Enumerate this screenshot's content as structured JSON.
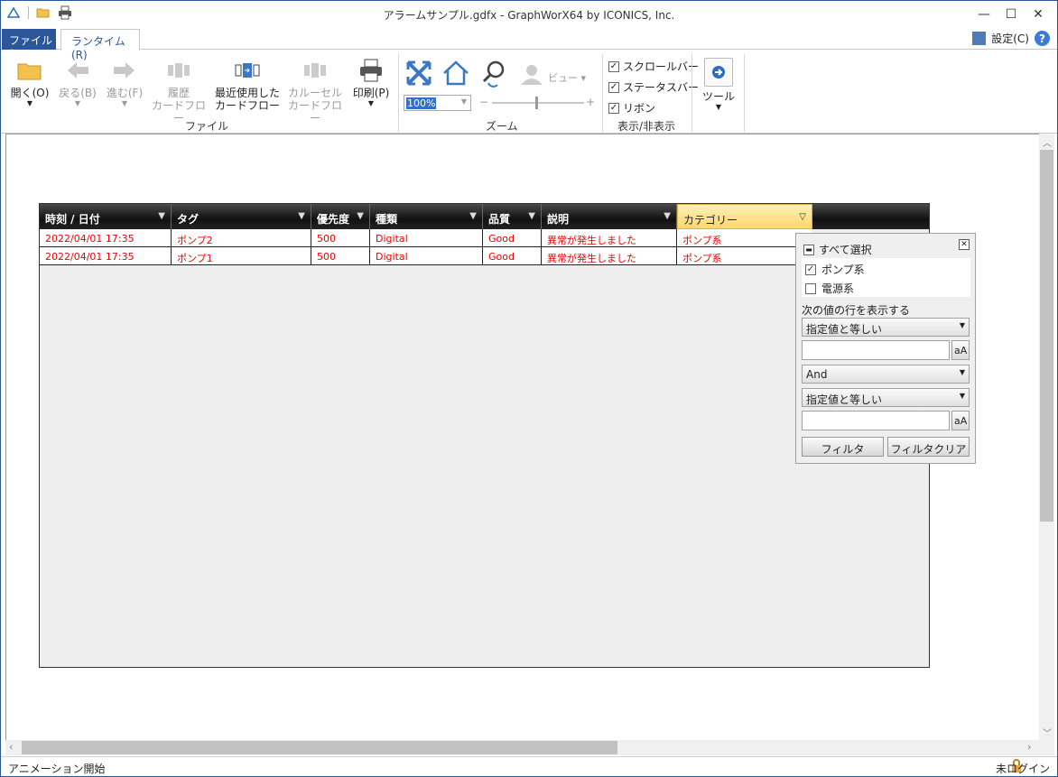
{
  "window": {
    "title": "アラームサンプル.gdfx - GraphWorX64 by ICONICS, Inc."
  },
  "tabs": {
    "file": "ファイル(F",
    "runtime": "ランタイム (R)"
  },
  "settings_label": "設定(C)",
  "help_label": "?",
  "ribbon": {
    "open": "開く(O)",
    "back": "戻る(B)",
    "forward": "進む(F)",
    "history_line1": "履歴",
    "history_line2": "カードフロー",
    "recent_line1": "最近使用した",
    "recent_line2": "カードフロー",
    "carousel_line1": "カルーセル",
    "carousel_line2": "カードフロー",
    "print": "印刷(P)",
    "file_group": "ファイル",
    "view": "ビュー",
    "zoom_value": "100%",
    "zoom_group": "ズーム",
    "zoom_minus": "−",
    "zoom_plus": "+",
    "scrollbar": "スクロールバー",
    "statusbar": "ステータスバー",
    "ribbon": "リボン",
    "show_hide_group": "表示/非表示",
    "tools": "ツール"
  },
  "grid": {
    "columns": [
      "時刻 / 日付",
      "タグ",
      "優先度",
      "種類",
      "品質",
      "説明",
      "カテゴリー"
    ],
    "rows": [
      [
        "2022/04/01 17:35",
        "ポンプ2",
        "500",
        "Digital",
        "Good",
        "異常が発生しました",
        "ポンプ系"
      ],
      [
        "2022/04/01 17:35",
        "ポンプ1",
        "500",
        "Digital",
        "Good",
        "異常が発生しました",
        "ポンプ系"
      ]
    ]
  },
  "filter_popup": {
    "select_all": "すべて選択",
    "items": [
      {
        "label": "ポンプ系",
        "checked": true
      },
      {
        "label": "電源系",
        "checked": false
      }
    ],
    "show_rows_label": "次の値の行を表示する",
    "condition1": "指定値と等しい",
    "operator": "And",
    "condition2": "指定値と等しい",
    "case_button": "aA",
    "filter_button": "フィルタ",
    "clear_button": "フィルタクリア"
  },
  "status": {
    "left": "アニメーション開始",
    "right": "未ログイン"
  },
  "colors": {
    "accent": "#2b579a",
    "alarm_text": "#e00000",
    "active_header": "#ffd76b"
  }
}
